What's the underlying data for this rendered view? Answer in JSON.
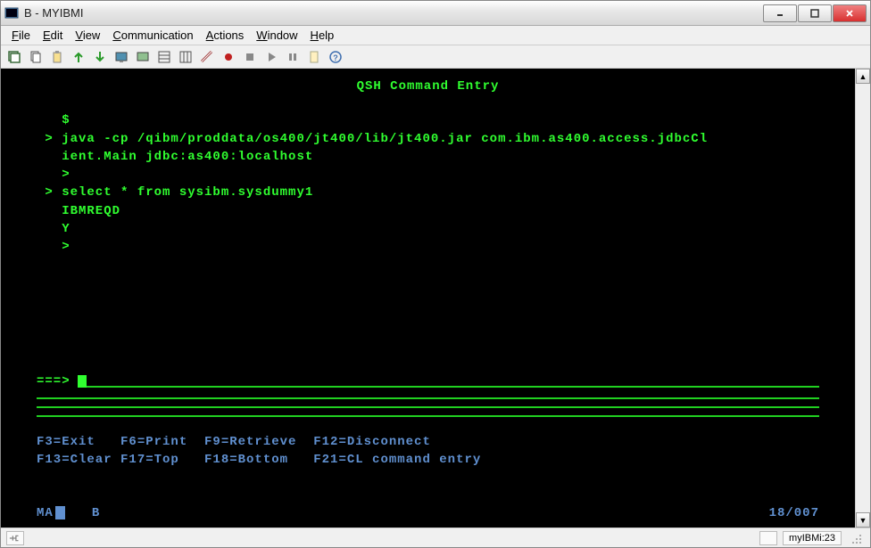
{
  "window": {
    "title": "B - MYIBMI"
  },
  "menu": {
    "file": "File",
    "edit": "Edit",
    "view": "View",
    "communication": "Communication",
    "actions": "Actions",
    "window": "Window",
    "help": "Help"
  },
  "terminal": {
    "title": "QSH Command Entry",
    "lines": {
      "dollar": "   $",
      "java1": " > java -cp /qibm/proddata/os400/jt400/lib/jt400.jar com.ibm.as400.access.jdbcCl",
      "java2": "   ient.Main jdbc:as400:localhost",
      "gt1": "   >",
      "select": " > select * from sysibm.sysdummy1",
      "ibmreqd": "   IBMREQD",
      "y": "   Y",
      "gt2": "   >"
    },
    "prompt": "===>",
    "fkeys1": "F3=Exit   F6=Print  F9=Retrieve  F12=Disconnect",
    "fkeys2": "F13=Clear F17=Top   F18=Bottom   F21=CL command entry",
    "status": {
      "ma": "MA",
      "b": "B",
      "cursor": "18/007"
    }
  },
  "statusbar": {
    "connection": "myIBMi:23"
  }
}
